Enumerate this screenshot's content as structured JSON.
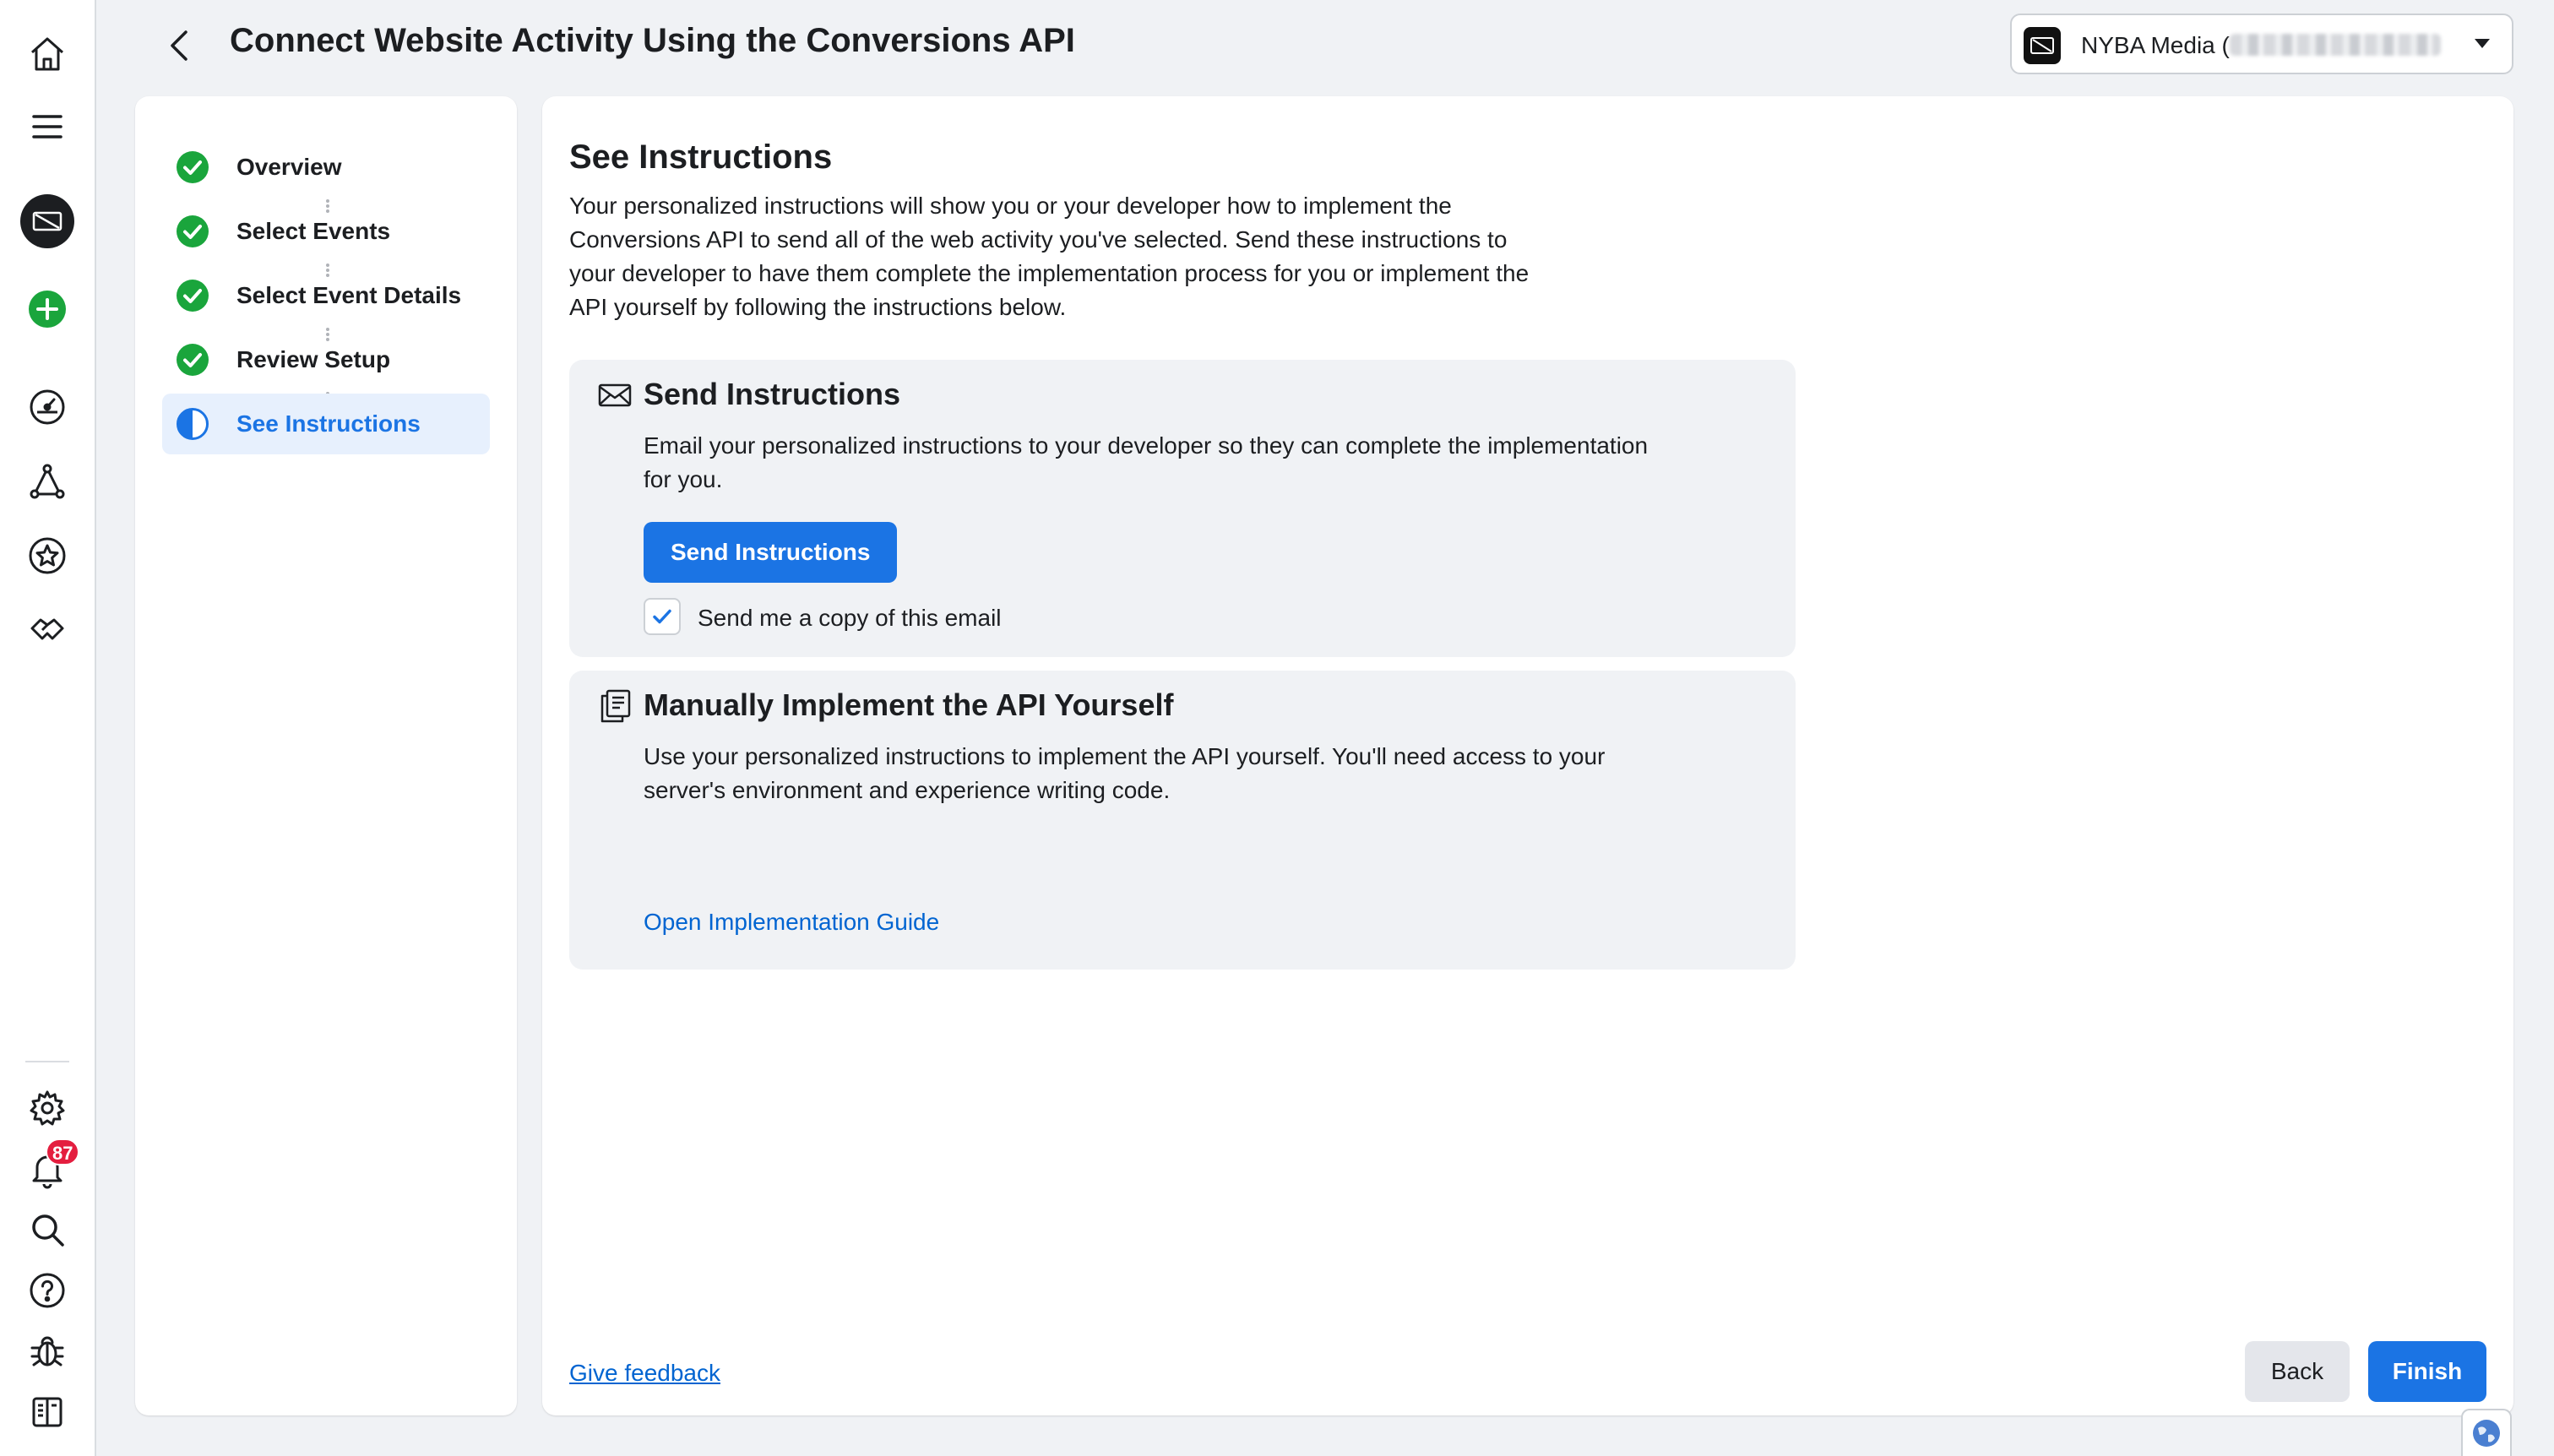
{
  "header": {
    "title": "Connect Website Activity Using the Conversions API",
    "account": {
      "name": "NYBA Media ("
    }
  },
  "nav_rail": {
    "top_icons": [
      "home-icon",
      "menu-icon",
      "account-avatar-icon",
      "create-icon",
      "dashboard-icon",
      "network-icon",
      "star-icon",
      "partnership-icon"
    ],
    "bottom_icons": [
      "settings-icon",
      "notifications-icon",
      "search-icon",
      "help-icon",
      "bug-icon",
      "panel-toggle-icon"
    ],
    "notification_count": "87",
    "colors": {
      "create": "#1aa53c",
      "badge": "#e41e3f"
    }
  },
  "steps": [
    {
      "label": "Overview",
      "status": "complete"
    },
    {
      "label": "Select Events",
      "status": "complete"
    },
    {
      "label": "Select Event Details",
      "status": "complete"
    },
    {
      "label": "Review Setup",
      "status": "complete"
    },
    {
      "label": "See Instructions",
      "status": "in-progress"
    }
  ],
  "main": {
    "title": "See Instructions",
    "intro": "Your personalized instructions will show you or your developer how to implement the Conversions API to send all of the web activity you've selected. Send these instructions to your developer to have them complete the implementation process for you or implement the API yourself by following the instructions below.",
    "send_card": {
      "icon": "envelope-icon",
      "title": "Send Instructions",
      "description": "Email your personalized instructions to your developer so they can complete the implementation for you.",
      "button": "Send Instructions",
      "checkbox_label": "Send me a copy of this email",
      "checkbox_checked": true
    },
    "manual_card": {
      "icon": "document-icon",
      "title": "Manually Implement the API Yourself",
      "description": "Use your personalized instructions to implement the API yourself. You'll need access to your server's environment and experience writing code.",
      "link": "Open Implementation Guide"
    },
    "feedback_link": "Give feedback"
  },
  "footer": {
    "back": "Back",
    "finish": "Finish"
  },
  "colors": {
    "primary": "#1b74e4",
    "success": "#1aa53c",
    "link": "#0064d1"
  }
}
